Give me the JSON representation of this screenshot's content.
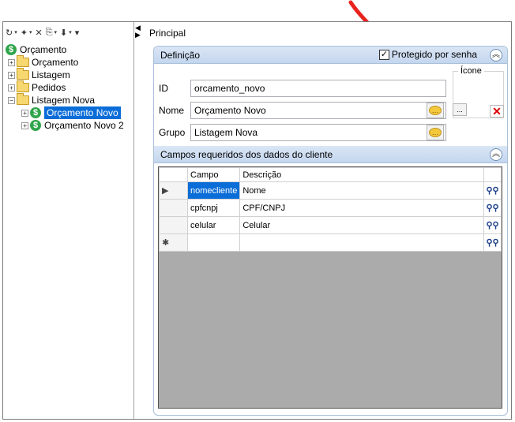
{
  "toolbar": {
    "items": [
      {
        "icon": "back-circle-icon",
        "glyph": "↻",
        "dropdown": true
      },
      {
        "icon": "new-document-icon",
        "glyph": "✦",
        "dropdown": true
      },
      {
        "icon": "delete-icon",
        "glyph": "✕",
        "dropdown": false
      },
      {
        "icon": "copy-icon",
        "glyph": "⎘",
        "dropdown": true
      },
      {
        "icon": "move-down-icon",
        "glyph": "⬇",
        "dropdown": true
      },
      {
        "icon": "more-icon",
        "glyph": "▾",
        "dropdown": false
      }
    ]
  },
  "tree": {
    "root": "Orçamento",
    "items": [
      {
        "label": "Orçamento",
        "type": "folder",
        "expander": "+"
      },
      {
        "label": "Listagem",
        "type": "folder",
        "expander": "+"
      },
      {
        "label": "Pedidos",
        "type": "folder",
        "expander": "+"
      },
      {
        "label": "Listagem Nova",
        "type": "folder",
        "expander": "−"
      },
      {
        "label": "Orçamento Novo",
        "type": "budget",
        "expander": "+",
        "selected": true
      },
      {
        "label": "Orçamento Novo 2",
        "type": "budget",
        "expander": "+"
      }
    ]
  },
  "right": {
    "title": "Principal"
  },
  "definicao": {
    "header": "Definição",
    "protected_label": "Protegido por senha",
    "protected_checked": true,
    "id_label": "ID",
    "id_value": "orcamento_novo",
    "nome_label": "Nome",
    "nome_value": "Orçamento Novo",
    "grupo_label": "Grupo",
    "grupo_value": "Listagem Nova",
    "icone_label": "Ícone",
    "browse_label": "..."
  },
  "campos": {
    "header": "Campos requeridos dos dados do cliente",
    "columns": [
      "Campo",
      "Descrição"
    ],
    "rows": [
      {
        "campo": "nomecliente",
        "descricao": "Nome"
      },
      {
        "campo": "cpfcnpj",
        "descricao": "CPF/CNPJ"
      },
      {
        "campo": "celular",
        "descricao": "Celular"
      }
    ]
  },
  "colors": {
    "accent": "#0a6dd8",
    "section_header": "#c4d6ee",
    "annotation_arrow": "#e8231e"
  }
}
